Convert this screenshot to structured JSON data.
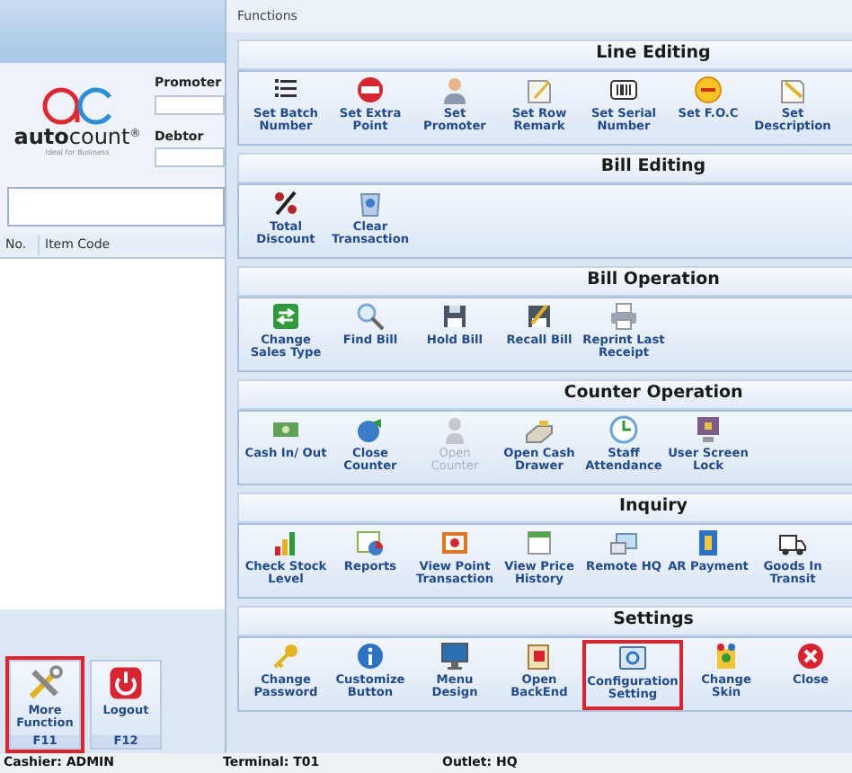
{
  "left_panel": {
    "logo": {
      "wordmark": "**auto**count",
      "registered": "®",
      "tagline": "Ideal for Business"
    },
    "promoter": {
      "label": "Promoter"
    },
    "debtor": {
      "label": "Debtor"
    },
    "table": {
      "columns": [
        "No.",
        "Item Code"
      ]
    },
    "buttons": [
      {
        "label": "More Function",
        "key": "F11",
        "highlighted": true
      },
      {
        "label": "Logout",
        "key": "F12",
        "highlighted": false
      }
    ]
  },
  "functions": {
    "title": "Functions",
    "sections": [
      {
        "title": "Line Editing",
        "buttons": [
          {
            "label": "Set Batch Number",
            "disabled": false,
            "highlighted": false
          },
          {
            "label": "Set Extra Point",
            "disabled": false,
            "highlighted": false
          },
          {
            "label": "Set Promoter",
            "disabled": false,
            "highlighted": false
          },
          {
            "label": "Set Row Remark",
            "disabled": false,
            "highlighted": false
          },
          {
            "label": "Set Serial Number",
            "disabled": false,
            "highlighted": false
          },
          {
            "label": "Set F.O.C",
            "disabled": false,
            "highlighted": false
          },
          {
            "label": "Set Description",
            "disabled": false,
            "highlighted": false
          }
        ]
      },
      {
        "title": "Bill Editing",
        "buttons": [
          {
            "label": "Total Discount",
            "disabled": false,
            "highlighted": false
          },
          {
            "label": "Clear Transaction",
            "disabled": false,
            "highlighted": false
          }
        ]
      },
      {
        "title": "Bill Operation",
        "buttons": [
          {
            "label": "Change Sales Type",
            "disabled": false,
            "highlighted": false
          },
          {
            "label": "Find Bill",
            "disabled": false,
            "highlighted": false
          },
          {
            "label": "Hold Bill",
            "disabled": false,
            "highlighted": false
          },
          {
            "label": "Recall Bill",
            "disabled": false,
            "highlighted": false
          },
          {
            "label": "Reprint Last Receipt",
            "disabled": false,
            "highlighted": false
          }
        ]
      },
      {
        "title": "Counter Operation",
        "buttons": [
          {
            "label": "Cash In/ Out",
            "disabled": false,
            "highlighted": false
          },
          {
            "label": "Close Counter",
            "disabled": false,
            "highlighted": false
          },
          {
            "label": "Open Counter",
            "disabled": true,
            "highlighted": false
          },
          {
            "label": "Open Cash Drawer",
            "disabled": false,
            "highlighted": false
          },
          {
            "label": "Staff Attendance",
            "disabled": false,
            "highlighted": false
          },
          {
            "label": "User Screen Lock",
            "disabled": false,
            "highlighted": false
          }
        ]
      },
      {
        "title": "Inquiry",
        "buttons": [
          {
            "label": "Check Stock Level",
            "disabled": false,
            "highlighted": false
          },
          {
            "label": "Reports",
            "disabled": false,
            "highlighted": false
          },
          {
            "label": "View Point Transaction",
            "disabled": false,
            "highlighted": false
          },
          {
            "label": "View Price History",
            "disabled": false,
            "highlighted": false
          },
          {
            "label": "Remote HQ",
            "disabled": false,
            "highlighted": false
          },
          {
            "label": "AR Payment",
            "disabled": false,
            "highlighted": false
          },
          {
            "label": "Goods In Transit",
            "disabled": false,
            "highlighted": false
          }
        ]
      },
      {
        "title": "Settings",
        "buttons": [
          {
            "label": "Change Password",
            "disabled": false,
            "highlighted": false
          },
          {
            "label": "Customize Button",
            "disabled": false,
            "highlighted": false
          },
          {
            "label": "Menu Design",
            "disabled": false,
            "highlighted": false
          },
          {
            "label": "Open BackEnd",
            "disabled": false,
            "highlighted": false
          },
          {
            "label": "Configuration Setting",
            "disabled": false,
            "highlighted": true
          },
          {
            "label": "Change Skin",
            "disabled": false,
            "highlighted": false
          },
          {
            "label": "Close",
            "disabled": false,
            "highlighted": false
          }
        ]
      }
    ]
  },
  "status_bar": [
    "Cashier: ADMIN",
    "Terminal: T01",
    "Outlet: HQ"
  ]
}
